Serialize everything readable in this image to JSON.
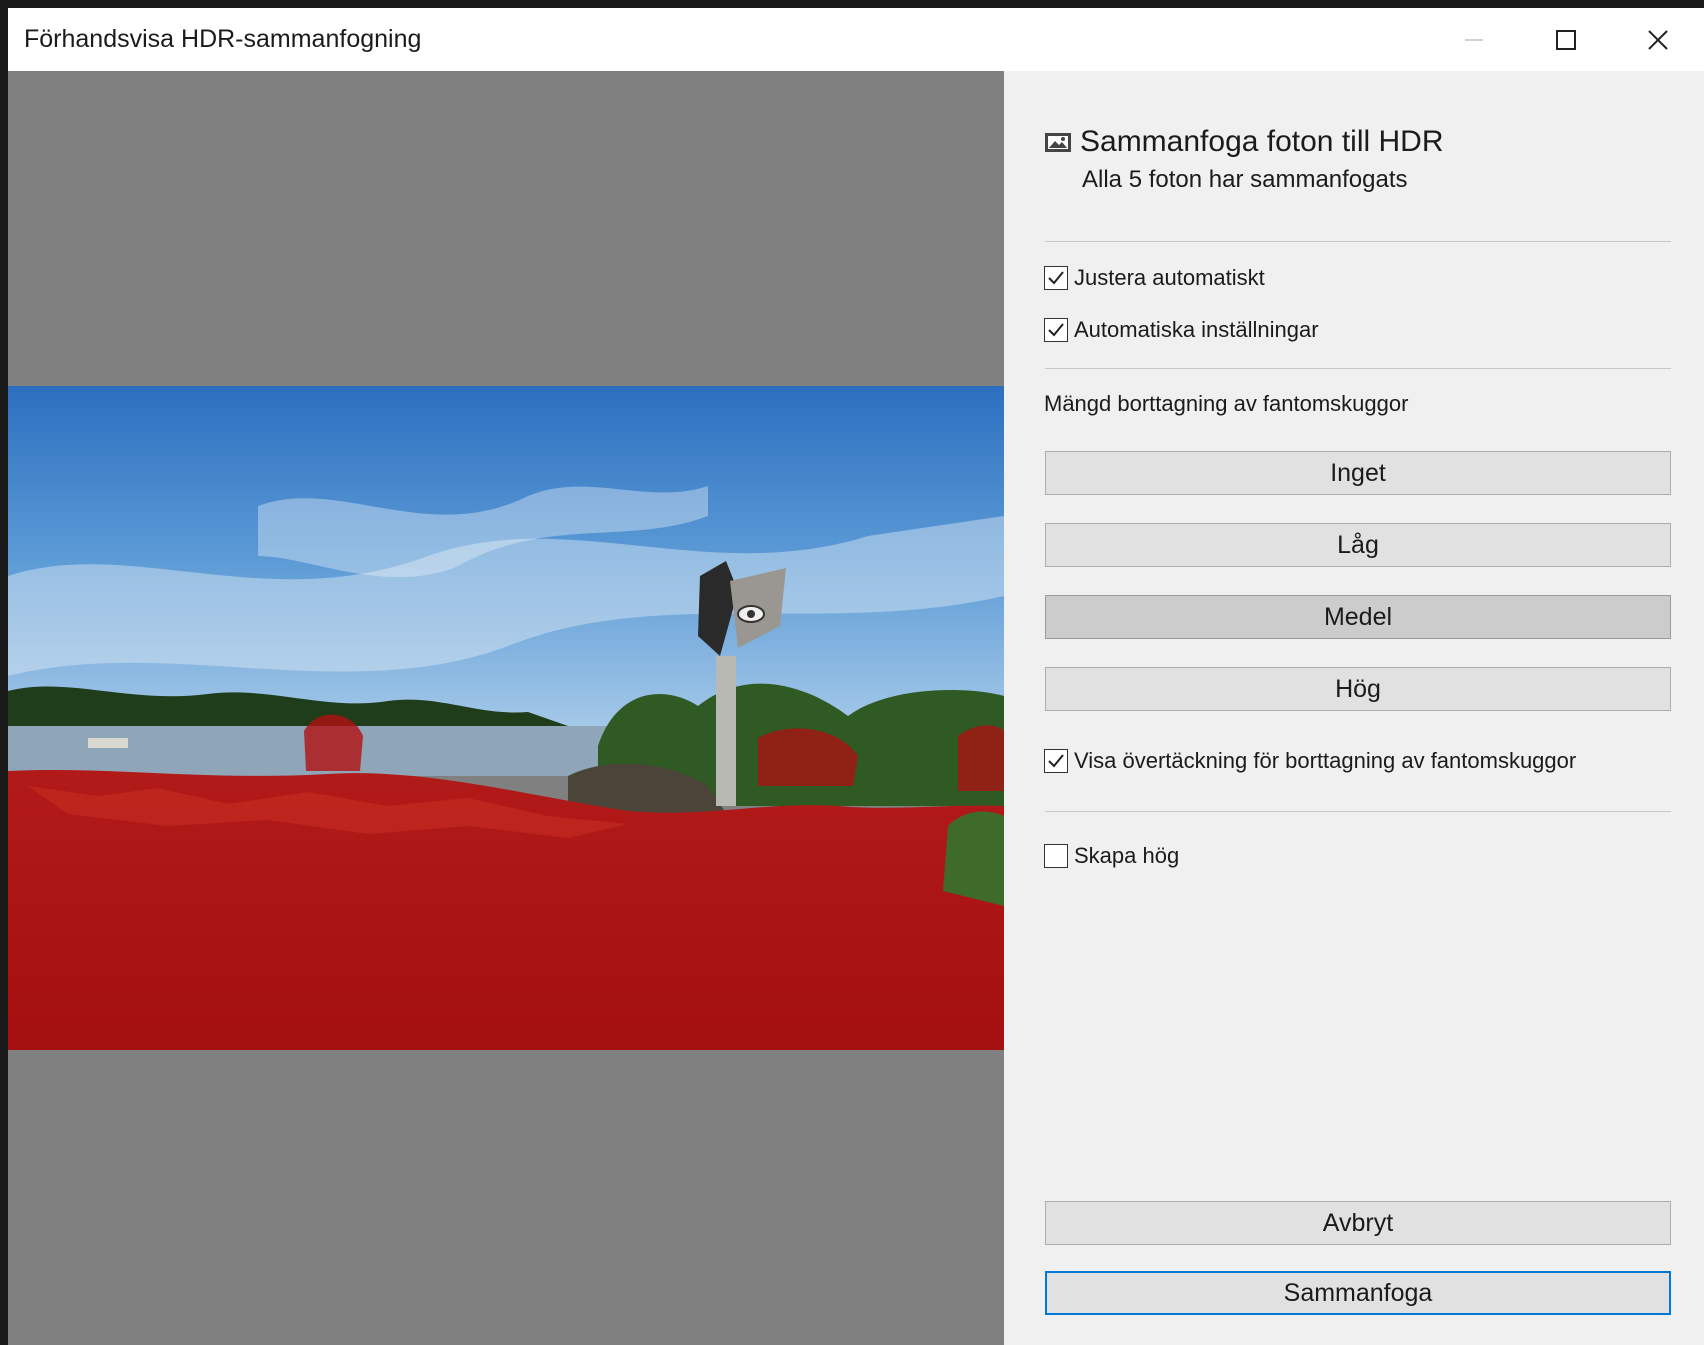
{
  "window": {
    "title": "Förhandsvisa HDR-sammanfogning",
    "controls": {
      "minimize": "—",
      "maximize": "☐",
      "close": "✕"
    }
  },
  "panel": {
    "title": "Sammanfoga foton till HDR",
    "subtitle": "Alla 5 foton har sammanfogats",
    "auto_adjust": {
      "label": "Justera automatiskt",
      "checked": true
    },
    "auto_settings": {
      "label": "Automatiska inställningar",
      "checked": true
    },
    "deghost_label": "Mängd borttagning av fantomskuggor",
    "deghost_options": [
      "Inget",
      "Låg",
      "Medel",
      "Hög"
    ],
    "deghost_selected": "Medel",
    "show_overlay": {
      "label": "Visa övertäckning för borttagning av fantomskuggor",
      "checked": true
    },
    "create_stack": {
      "label": "Skapa hög",
      "checked": false
    },
    "cancel_label": "Avbryt",
    "merge_label": "Sammanfoga"
  },
  "colors": {
    "overlay_red": "#b01010",
    "primary_border": "#0078d7"
  }
}
